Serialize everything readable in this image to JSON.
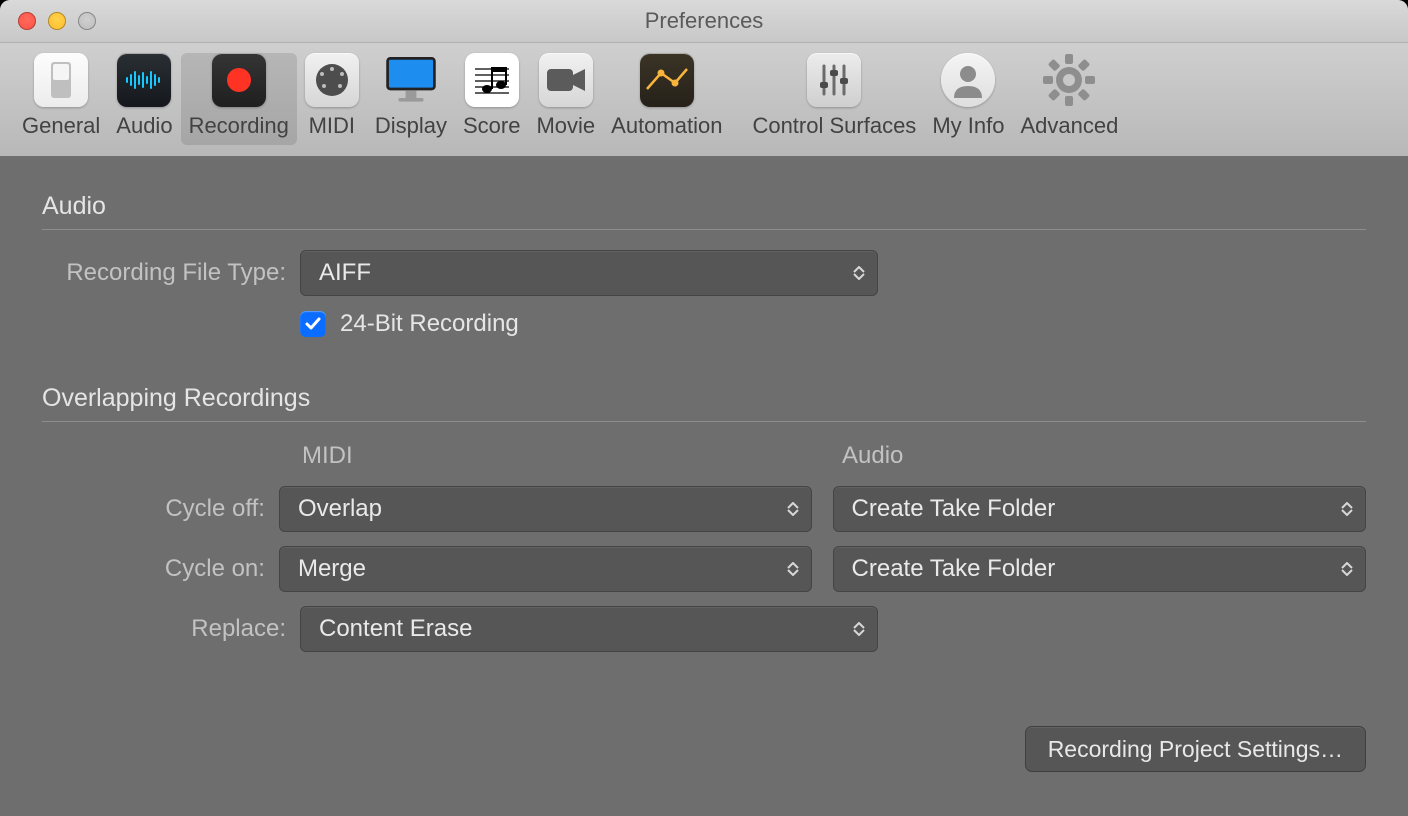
{
  "window": {
    "title": "Preferences"
  },
  "toolbar": {
    "general": "General",
    "audio": "Audio",
    "recording": "Recording",
    "midi": "MIDI",
    "display": "Display",
    "score": "Score",
    "movie": "Movie",
    "automation": "Automation",
    "control_surfaces": "Control Surfaces",
    "my_info": "My Info",
    "advanced": "Advanced"
  },
  "audio_section": {
    "title": "Audio",
    "file_type_label": "Recording File Type:",
    "file_type_value": "AIFF",
    "bit_depth_label": "24-Bit Recording",
    "bit_depth_checked": true
  },
  "overlap_section": {
    "title": "Overlapping Recordings",
    "midi_header": "MIDI",
    "audio_header": "Audio",
    "cycle_off_label": "Cycle off:",
    "cycle_on_label": "Cycle on:",
    "replace_label": "Replace:",
    "midi_cycle_off": "Overlap",
    "midi_cycle_on": "Merge",
    "midi_replace": "Content Erase",
    "audio_cycle_off": "Create Take Folder",
    "audio_cycle_on": "Create Take Folder"
  },
  "footer": {
    "project_settings": "Recording Project Settings…"
  }
}
